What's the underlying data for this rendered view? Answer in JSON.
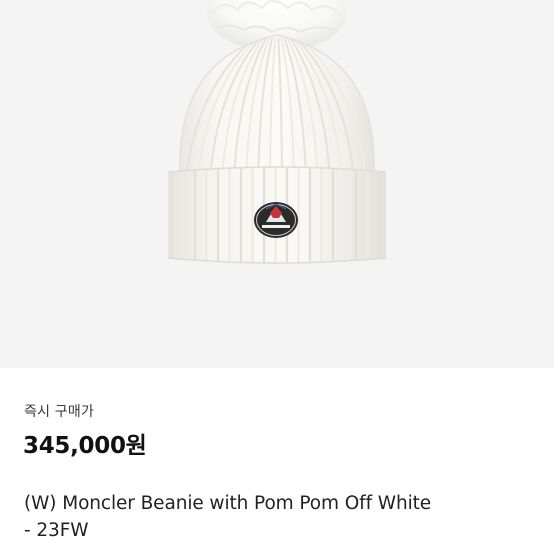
{
  "product": {
    "image_alt_icon": "beanie-product-photo",
    "brand_patch_icon": "moncler-logo-patch-icon"
  },
  "pricing": {
    "caption": "즉시 구매가",
    "price": "345,000원"
  },
  "title": {
    "line1": "(W) Moncler Beanie with Pom Pom Off White",
    "line2": "- 23FW"
  },
  "colors": {
    "background": "#f4f4f4",
    "hat": "#f6f5f1",
    "text": "#222222",
    "price": "#111111"
  }
}
